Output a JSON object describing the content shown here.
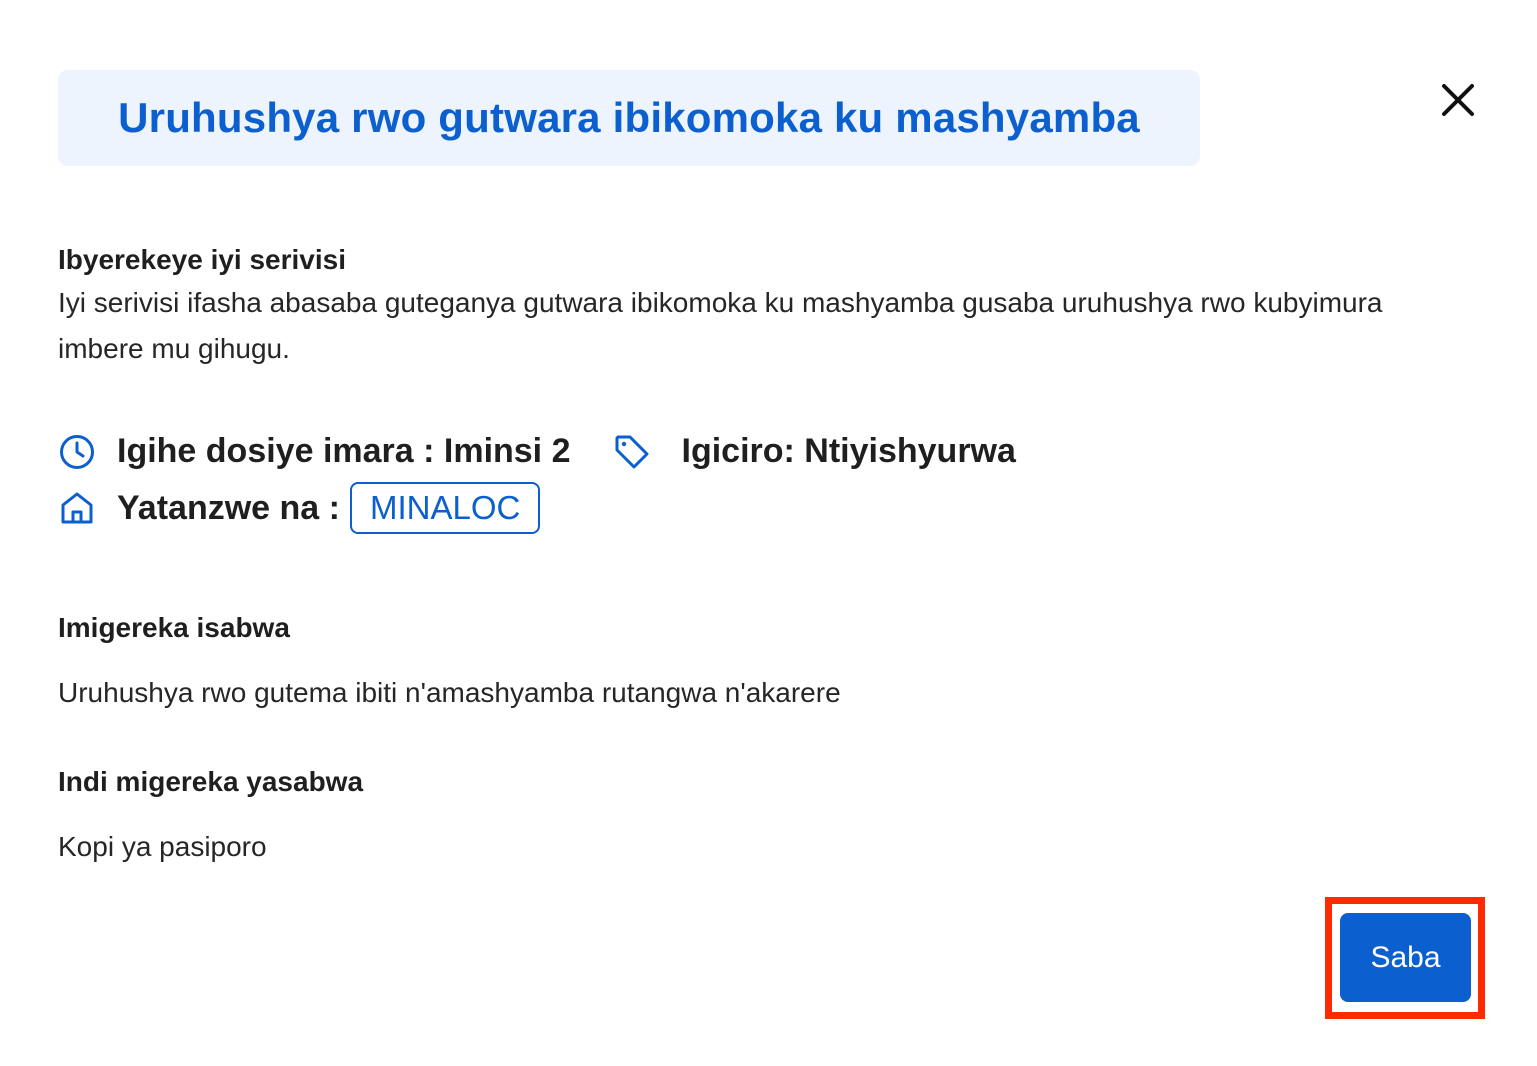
{
  "dialog": {
    "title": "Uruhushya rwo gutwara ibikomoka ku mashyamba",
    "close_icon": "close-icon"
  },
  "about": {
    "heading": "Ibyerekeye iyi serivisi",
    "description": "Iyi serivisi ifasha abasaba guteganya gutwara ibikomoka ku mashyamba gusaba uruhushya rwo kubyimura imbere mu gihugu."
  },
  "meta": {
    "duration_label": "Igihe dosiye imara : Iminsi 2",
    "duration_icon": "clock-icon",
    "price_label": "Igiciro: Ntiyishyurwa",
    "price_icon": "tag-icon",
    "provider_label": "Yatanzwe na :",
    "provider_icon": "home-icon",
    "provider_value": "MINALOC"
  },
  "requirements": {
    "heading": "Imigereka isabwa",
    "value": "Uruhushya rwo gutema ibiti n'amashyamba rutangwa n'akarere"
  },
  "other_requirements": {
    "heading": "Indi migereka yasabwa",
    "value": "Kopi ya pasiporo"
  },
  "actions": {
    "apply_label": "Saba"
  },
  "colors": {
    "accent": "#0b5fcf",
    "title_bg": "#eef4fd",
    "highlight": "#ff2a00"
  }
}
